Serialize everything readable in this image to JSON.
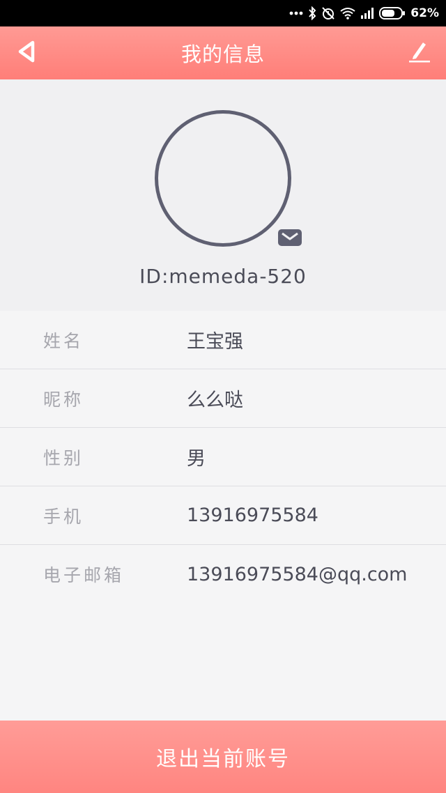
{
  "status_bar": {
    "battery_percent": "62%",
    "icons": [
      "more-dots-icon",
      "bluetooth-icon",
      "alarm-off-icon",
      "wifi-icon",
      "signal-icon",
      "battery-icon"
    ]
  },
  "header": {
    "title": "我的信息",
    "back_icon": "back-arrow-icon",
    "edit_icon": "edit-pencil-icon"
  },
  "profile": {
    "id_text": "ID:memeda-520",
    "badge_icon": "mail-icon"
  },
  "info": {
    "rows": [
      {
        "label": "姓名",
        "value": "王宝强"
      },
      {
        "label": "昵称",
        "value": "么么哒"
      },
      {
        "label": "性别",
        "value": "男"
      },
      {
        "label": "手机",
        "value": "13916975584"
      },
      {
        "label": "电子邮箱",
        "value": "13916975584@qq.com"
      }
    ]
  },
  "footer": {
    "logout_label": "退出当前账号"
  },
  "colors": {
    "accent": "#ff8a84",
    "avatar_ring": "#5f6072",
    "text_primary": "#4a4b57",
    "text_label": "#a6a6ad"
  }
}
